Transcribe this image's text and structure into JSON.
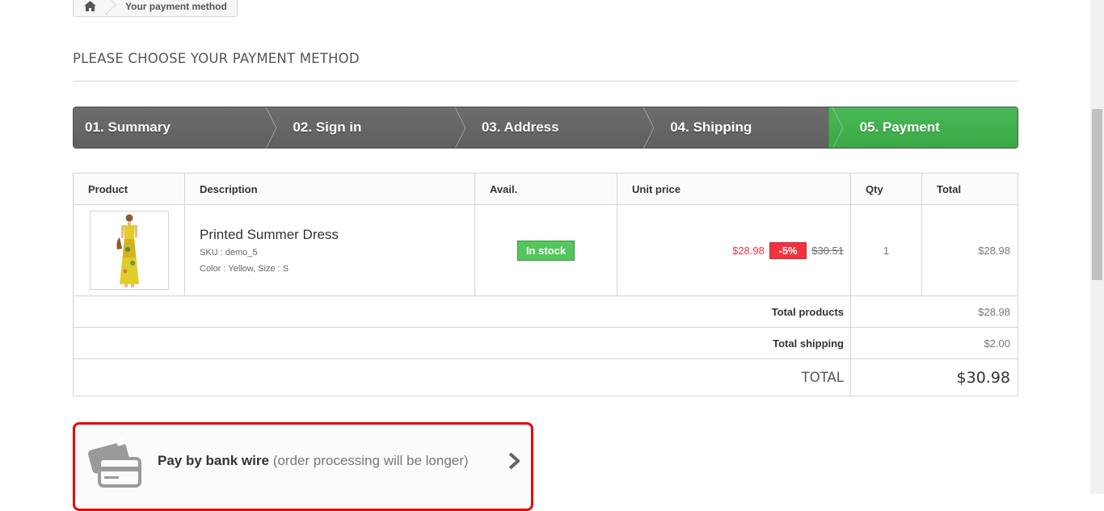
{
  "breadcrumb": {
    "home_icon": "home-icon",
    "current": "Your payment method"
  },
  "heading": "PLEASE CHOOSE YOUR PAYMENT METHOD",
  "steps": [
    {
      "label": "01. Summary"
    },
    {
      "label": "02. Sign in"
    },
    {
      "label": "03. Address"
    },
    {
      "label": "04. Shipping"
    },
    {
      "label": "05. Payment",
      "active": true
    }
  ],
  "cart": {
    "headers": {
      "product": "Product",
      "description": "Description",
      "avail": "Avail.",
      "unit_price": "Unit price",
      "qty": "Qty",
      "total": "Total"
    },
    "item": {
      "name": "Printed Summer Dress",
      "sku": "SKU : demo_5",
      "attributes": "Color : Yellow, Size : S",
      "availability": "In stock",
      "price_new": "$28.98",
      "reduction": "-5%",
      "price_old": "$30.51",
      "qty": "1",
      "total": "$28.98"
    },
    "totals": {
      "products_label": "Total products",
      "products_value": "$28.98",
      "shipping_label": "Total shipping",
      "shipping_value": "$2.00",
      "total_label": "TOTAL",
      "total_value": "$30.98"
    }
  },
  "payment": {
    "title": "Pay by bank wire",
    "subtitle": "(order processing will be longer)",
    "icon": "credit-card-icon"
  },
  "colors": {
    "step_active": "#46b254",
    "step_default": "#666666",
    "stock_badge": "#55c65e",
    "price_red": "#f13340",
    "payment_border": "#e2060d"
  }
}
